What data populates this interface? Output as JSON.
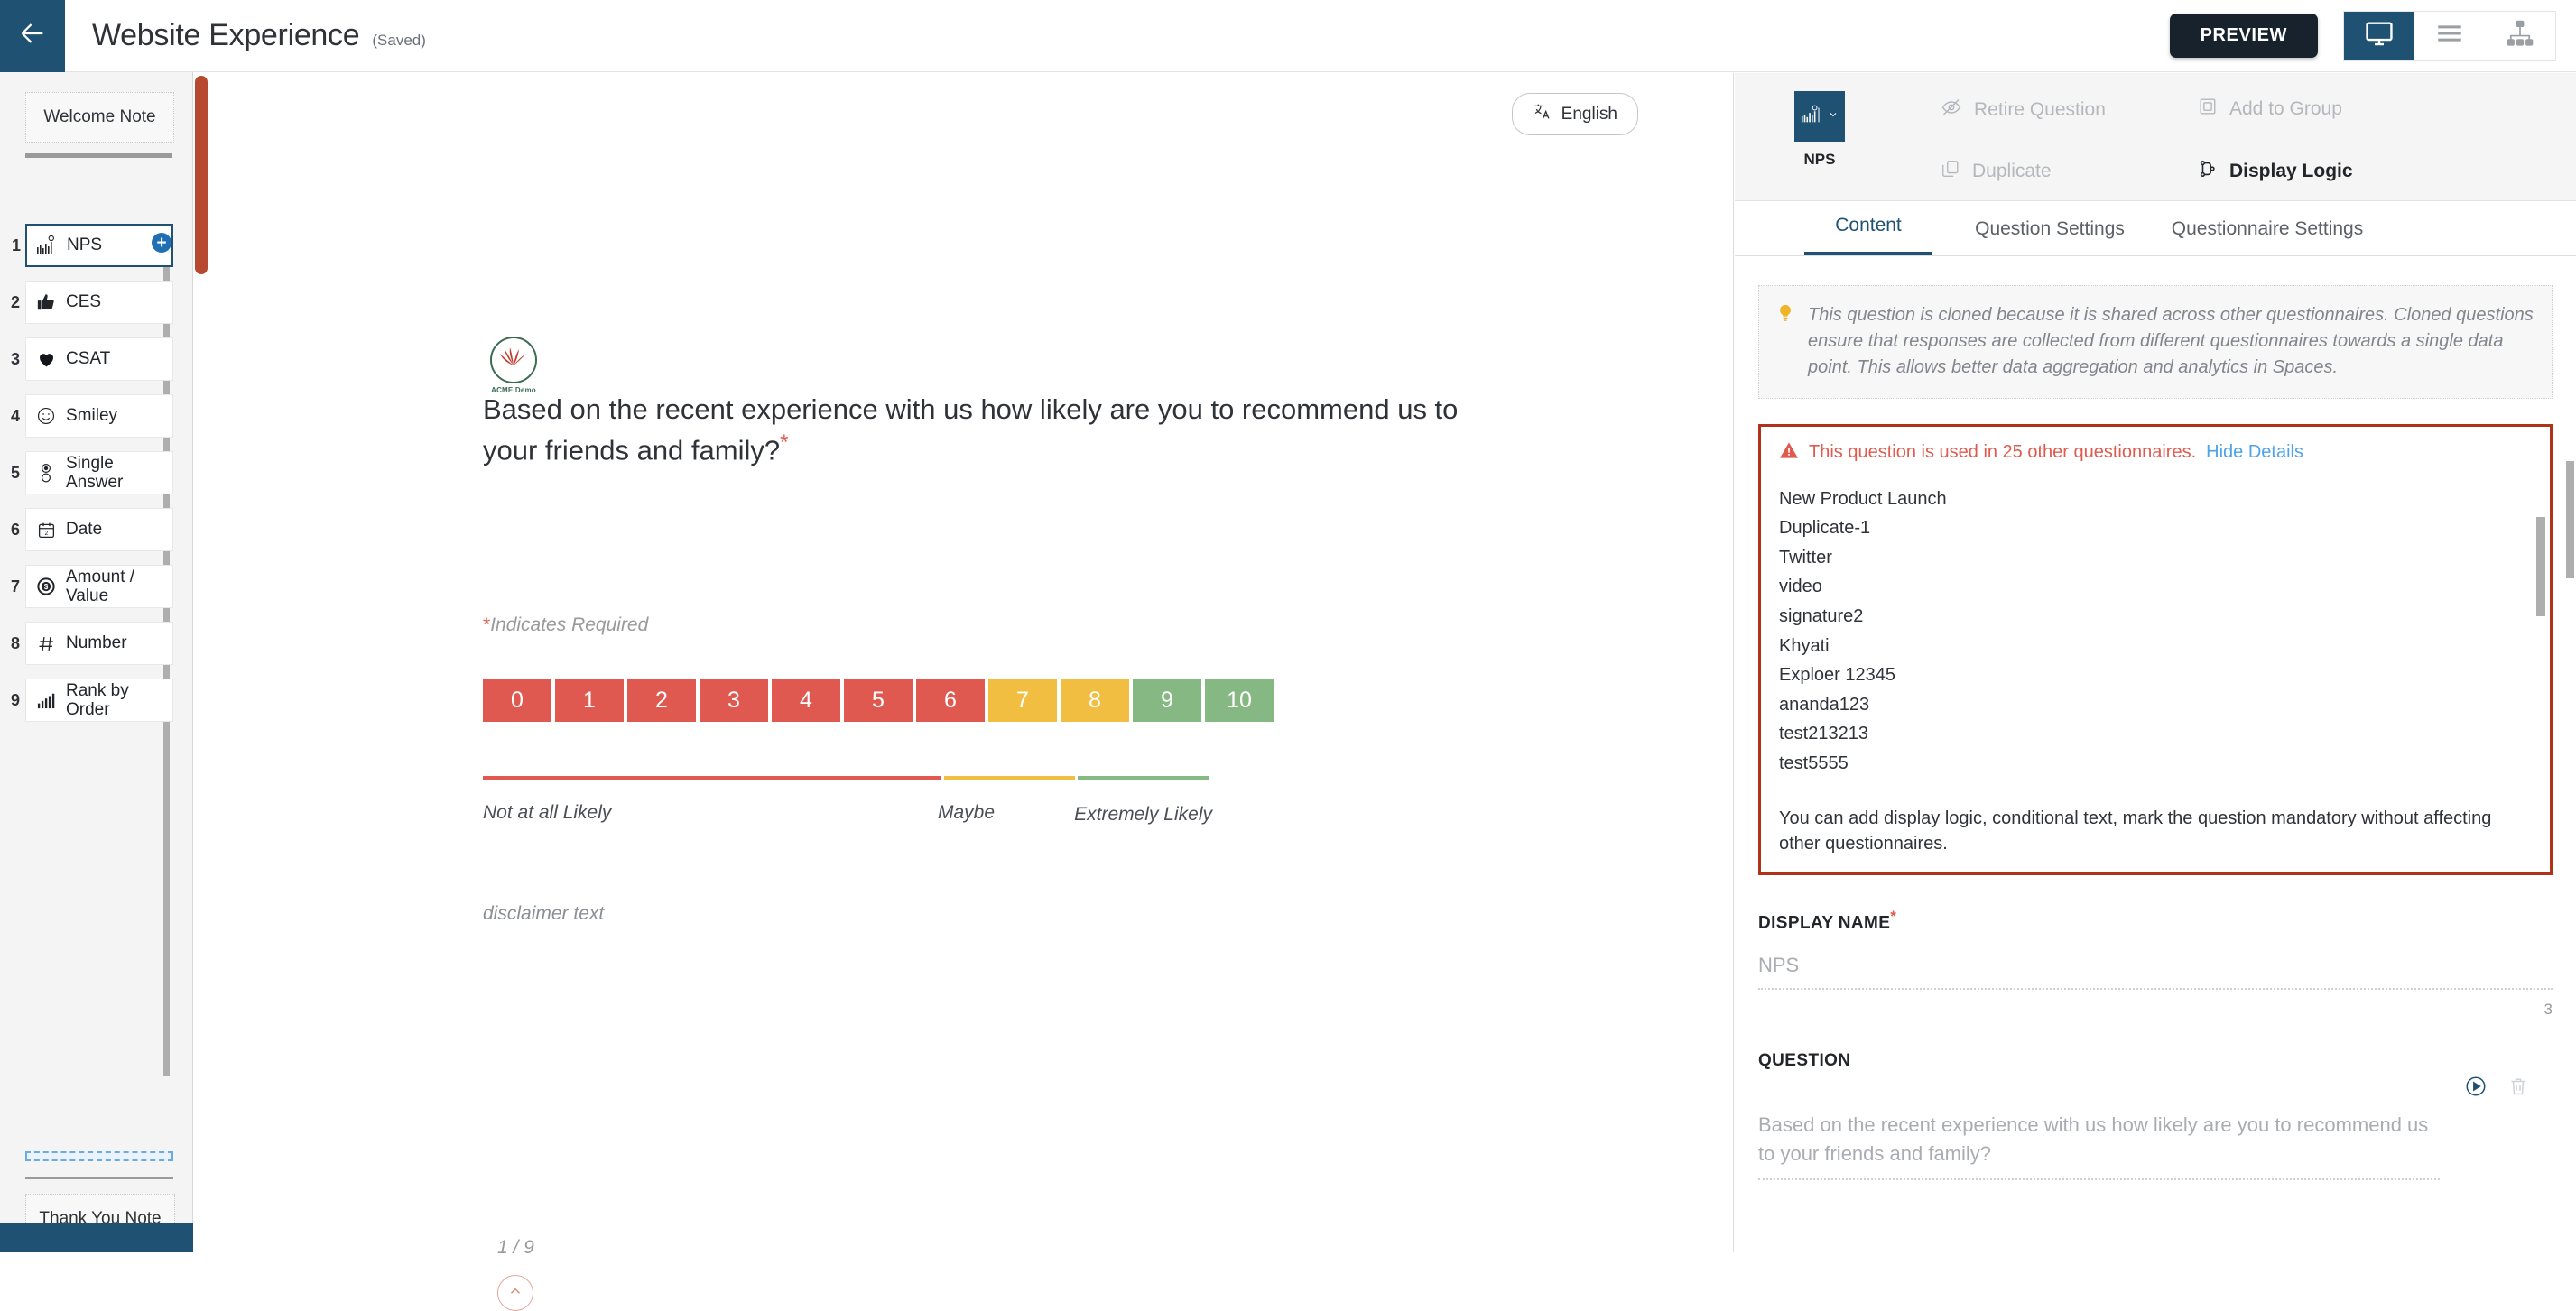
{
  "topbar": {
    "back_icon": "arrow-left-icon",
    "title": "Website Experience",
    "saved_state": "(Saved)",
    "preview_label": "PREVIEW",
    "view_buttons": [
      {
        "icon": "desktop-monitor-icon",
        "active": true
      },
      {
        "icon": "list-lines-icon",
        "active": false
      },
      {
        "icon": "sitemap-tree-icon",
        "active": false
      }
    ]
  },
  "sidebar": {
    "welcome_note": "Welcome Note",
    "thank_you_note": "Thank You Note",
    "add_button": "+",
    "questions": [
      {
        "num": "1",
        "label": "NPS",
        "icon": "nps-bars-icon",
        "selected": true
      },
      {
        "num": "2",
        "label": "CES",
        "icon": "thumbs-up-icon",
        "selected": false
      },
      {
        "num": "3",
        "label": "CSAT",
        "icon": "heart-icon",
        "selected": false
      },
      {
        "num": "4",
        "label": "Smiley",
        "icon": "smiley-face-icon",
        "selected": false
      },
      {
        "num": "5",
        "label": "Single Answer",
        "icon": "radio-button-icon",
        "selected": false
      },
      {
        "num": "6",
        "label": "Date",
        "icon": "calendar-icon",
        "selected": false
      },
      {
        "num": "7",
        "label": "Amount / Value",
        "icon": "dollar-coin-icon",
        "selected": false
      },
      {
        "num": "8",
        "label": "Number",
        "icon": "hash-icon",
        "selected": false
      },
      {
        "num": "9",
        "label": "Rank by Order",
        "icon": "bar-chart-icon",
        "selected": false
      }
    ]
  },
  "preview": {
    "language_label": "English",
    "language_icon": "translate-icon",
    "logo_label": "ACME Demo",
    "question_text": "Based on the recent experience with us how likely are you to recommend us to your friends and family?",
    "required_marker": "*",
    "indicates_required": "Indicates Required",
    "scale": {
      "values": [
        "0",
        "1",
        "2",
        "3",
        "4",
        "5",
        "6",
        "7",
        "8",
        "9",
        "10"
      ],
      "colors": [
        "#df5951",
        "#df5951",
        "#df5951",
        "#df5951",
        "#df5951",
        "#df5951",
        "#df5951",
        "#f2be42",
        "#f2be42",
        "#86b883",
        "#86b883"
      ],
      "label_left": "Not at all Likely",
      "label_mid": "Maybe",
      "label_right": "Extremely Likely"
    },
    "disclaimer": "disclaimer text",
    "page_indicator": "1 / 9",
    "scroll_up_icon": "chevron-up-icon"
  },
  "right_panel": {
    "question_type": {
      "label": "NPS",
      "icon": "nps-bars-icon",
      "dropdown_icon": "chevron-down-icon"
    },
    "tools": [
      {
        "label": "Retire Question",
        "icon": "eye-slash-icon",
        "enabled": false
      },
      {
        "label": "Duplicate",
        "icon": "copy-icon",
        "enabled": false
      },
      {
        "label": "Add to Group",
        "icon": "group-box-icon",
        "enabled": false
      },
      {
        "label": "Display Logic",
        "icon": "branch-logic-icon",
        "enabled": true
      }
    ],
    "tabs": [
      {
        "label": "Content",
        "active": true
      },
      {
        "label": "Question Settings",
        "active": false
      },
      {
        "label": "Questionnaire Settings",
        "active": false
      }
    ],
    "info_notice": {
      "icon": "lightbulb-icon",
      "text": "This question is cloned because it is shared across other questionnaires. Cloned questions ensure that responses are collected from different questionnaires towards a single data point. This allows better data aggregation and analytics in Spaces."
    },
    "warning": {
      "icon": "warning-triangle-icon",
      "message": "This question is used in 25 other questionnaires.",
      "toggle_link": "Hide Details",
      "questionnaires": [
        "New Product Launch",
        "Duplicate-1",
        "Twitter",
        "video",
        "signature2",
        "Khyati",
        "Exploer 12345",
        "ananda123",
        "test213213",
        "test5555"
      ],
      "footnote": "You can add display logic, conditional text, mark the question mandatory without affecting other questionnaires."
    },
    "display_name": {
      "label": "DISPLAY NAME",
      "required_marker": "*",
      "value": "NPS",
      "char_count": "3"
    },
    "question_field": {
      "label": "QUESTION",
      "value": "Based on the recent experience with us how likely are you to recommend us to your friends and family?",
      "play_icon": "play-circle-icon",
      "delete_icon": "trash-icon"
    }
  },
  "colors": {
    "brand_blue": "#1f5173",
    "detractor_red": "#df5951",
    "passive_yellow": "#f2be42",
    "promoter_green": "#86b883",
    "warning_border": "#b03218",
    "link_blue": "#4da3e8",
    "accent_orange": "#b6492f"
  }
}
